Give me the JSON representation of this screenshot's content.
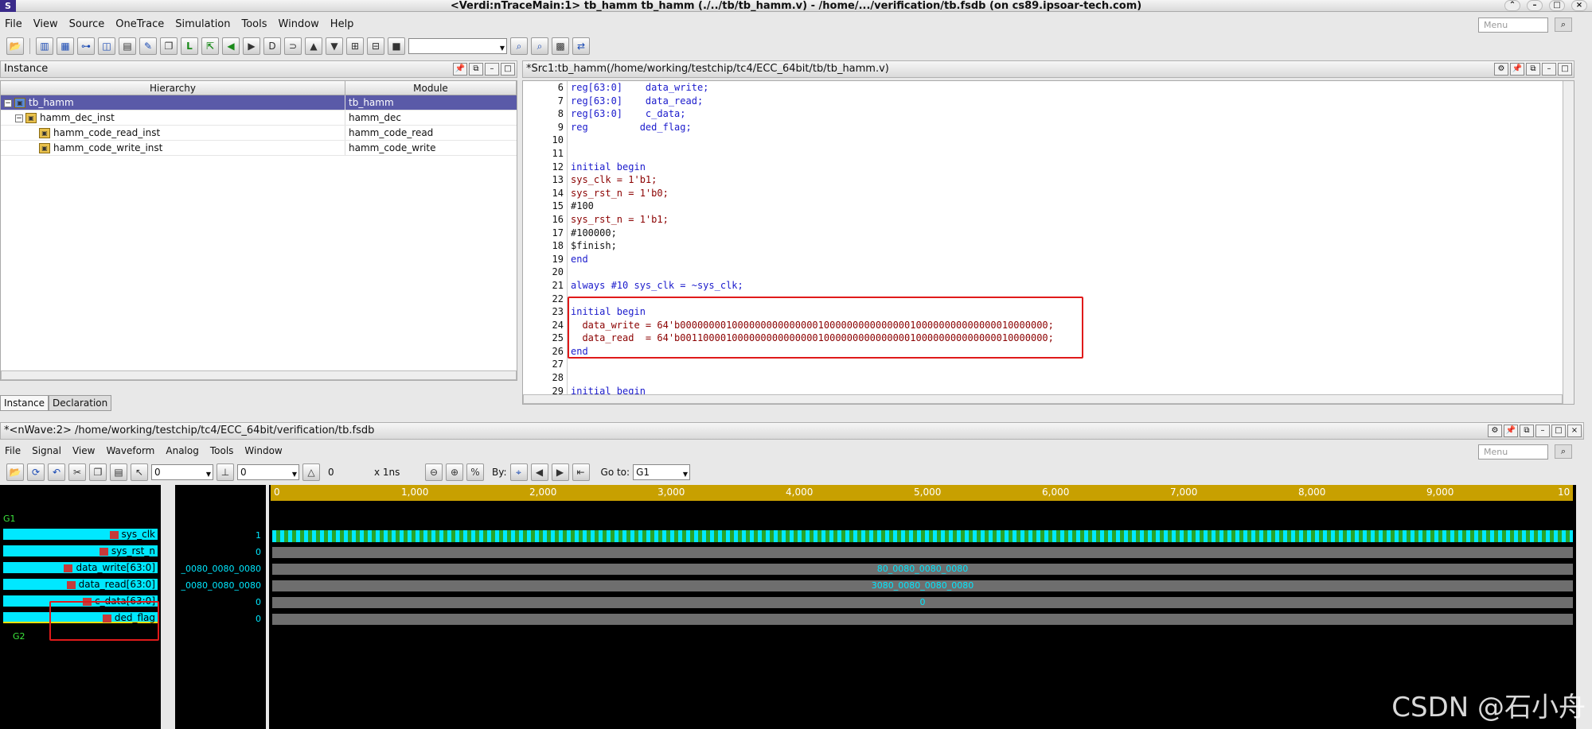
{
  "window": {
    "title": "<Verdi:nTraceMain:1> tb_hamm tb_hamm (./../tb/tb_hamm.v) - /home/.../verification/tb.fsdb (on cs89.ipsoar-tech.com)"
  },
  "menubar": {
    "items": [
      "File",
      "View",
      "Source",
      "OneTrace",
      "Simulation",
      "Tools",
      "Window",
      "Help"
    ],
    "menu_placeholder": "Menu"
  },
  "toolbar": {
    "combo_value": ""
  },
  "instance_panel": {
    "title": "Instance",
    "col_hierarchy": "Hierarchy",
    "col_module": "Module",
    "rows": [
      {
        "name": "tb_hamm",
        "module": "tb_hamm"
      },
      {
        "name": "hamm_dec_inst",
        "module": "hamm_dec"
      },
      {
        "name": "hamm_code_read_inst",
        "module": "hamm_code_read"
      },
      {
        "name": "hamm_code_write_inst",
        "module": "hamm_code_write"
      }
    ],
    "tab_instance": "Instance",
    "tab_declaration": "Declaration"
  },
  "source_panel": {
    "title": "*Src1:tb_hamm(/home/working/testchip/tc4/ECC_64bit/tb/tb_hamm.v)",
    "line_numbers": [
      "6",
      "7",
      "8",
      "9",
      "10",
      "11",
      "12",
      "13",
      "14",
      "15",
      "16",
      "17",
      "18",
      "19",
      "20",
      "21",
      "22",
      "23",
      "24",
      "25",
      "26",
      "27",
      "28",
      "29"
    ],
    "lines": [
      "reg[63:0]    data_write;",
      "reg[63:0]    data_read;",
      "reg[63:0]    c_data;",
      "reg         ded_flag;",
      "",
      "",
      "initial begin",
      "sys_clk = 1'b1;",
      "sys_rst_n = 1'b0;",
      "#100",
      "sys_rst_n = 1'b1;",
      "#100000;",
      "$finish;",
      "end",
      "",
      "always #10 sys_clk = ~sys_clk;",
      "",
      "initial begin",
      "  data_write = 64'b0000000010000000000000001000000000000000100000000000000010000000;",
      "  data_read  = 64'b0011000010000000000000001000000000000000100000000000000010000000;",
      "end",
      "",
      "",
      "initial begin"
    ]
  },
  "wave_window": {
    "title": "*<nWave:2> /home/working/testchip/tc4/ECC_64bit/verification/tb.fsdb",
    "menubar": [
      "File",
      "Signal",
      "View",
      "Waveform",
      "Analog",
      "Tools",
      "Window"
    ],
    "menu_placeholder": "Menu",
    "cursor1": "0",
    "cursor2": "0",
    "delta": "0",
    "unit": "x 1ns",
    "by_label": "By:",
    "goto_label": "Go to:",
    "goto_value": "G1",
    "group1": "G1",
    "group2": "G2",
    "signals": [
      {
        "name": "sys_clk",
        "value": "1",
        "wave": ""
      },
      {
        "name": "sys_rst_n",
        "value": "0",
        "wave": ""
      },
      {
        "name": "data_write[63:0]",
        "value": "_0080_0080_0080",
        "wave": "80_0080_0080_0080"
      },
      {
        "name": "data_read[63:0]",
        "value": "_0080_0080_0080",
        "wave": "3080_0080_0080_0080"
      },
      {
        "name": "c_data[63:0]",
        "value": "0",
        "wave": "0"
      },
      {
        "name": "ded_flag",
        "value": "0",
        "wave": ""
      }
    ],
    "ruler_ticks": [
      "0",
      "1,000",
      "2,000",
      "3,000",
      "4,000",
      "5,000",
      "6,000",
      "7,000",
      "8,000",
      "9,000",
      "10"
    ]
  },
  "watermark": "CSDN @石小舟"
}
